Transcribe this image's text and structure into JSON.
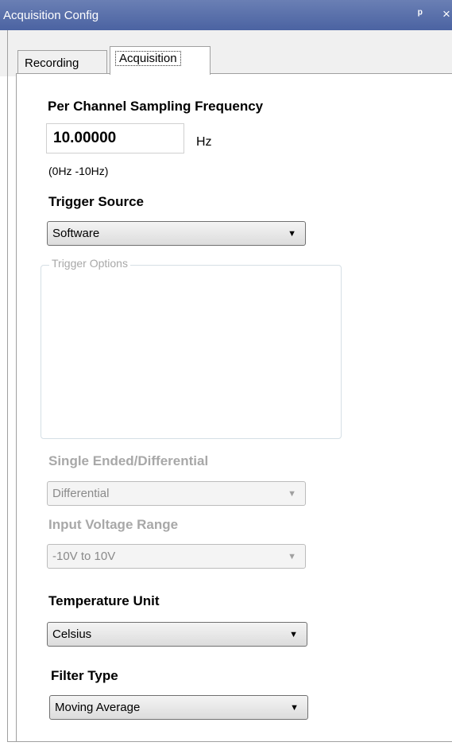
{
  "window": {
    "title": "Acquisition Config",
    "pin_glyph": "ᵖ",
    "close_glyph": "×"
  },
  "tabs": [
    {
      "label": "Recording",
      "selected": false
    },
    {
      "label": "Acquisition",
      "selected": true
    }
  ],
  "sampling": {
    "label": "Per Channel Sampling Frequency",
    "value": "10.00000",
    "unit": "Hz",
    "range": "(0Hz -10Hz)"
  },
  "trigger_source": {
    "label": "Trigger Source",
    "value": "Software"
  },
  "trigger_options": {
    "title": "Trigger Options"
  },
  "single_ended": {
    "label": "Single Ended/Differential",
    "value": "Differential",
    "enabled": false
  },
  "input_voltage": {
    "label": "Input Voltage Range",
    "value": "-10V to 10V",
    "enabled": false
  },
  "temperature_unit": {
    "label": "Temperature Unit",
    "value": "Celsius"
  },
  "filter_type": {
    "label": "Filter Type",
    "value": "Moving Average"
  },
  "icons": {
    "dropdown": "chevron-down-icon",
    "pin": "pin-icon",
    "close": "close-icon"
  },
  "colors": {
    "titlebar": "#5a6fab",
    "disabled_text": "#a8a8a8"
  }
}
